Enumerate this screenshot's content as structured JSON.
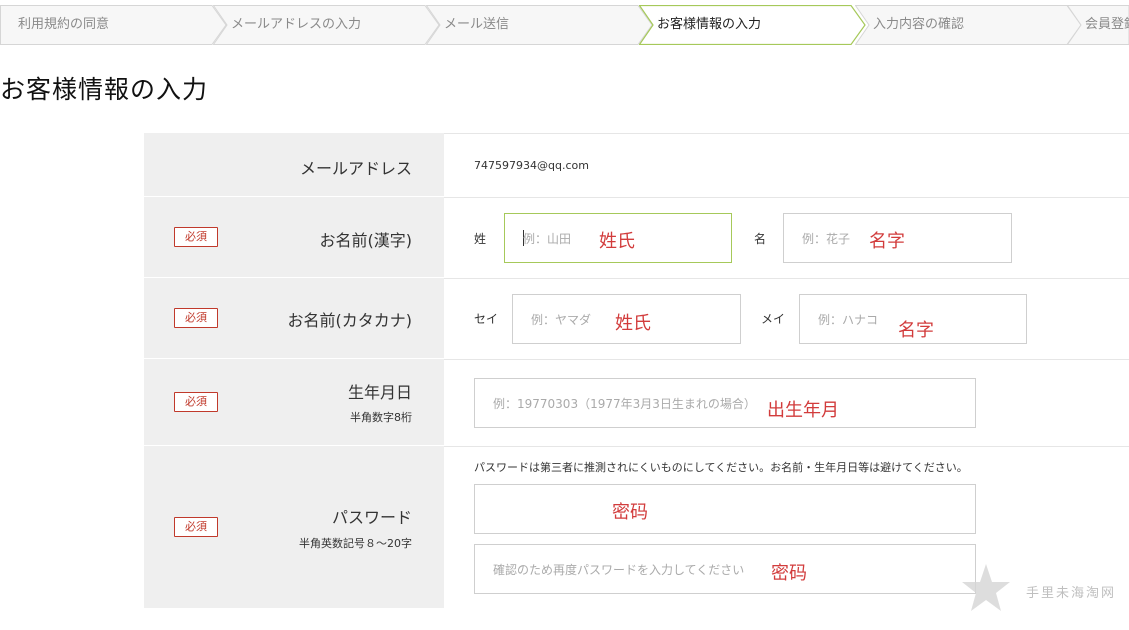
{
  "steps": [
    {
      "label": "利用規約の同意",
      "active": false
    },
    {
      "label": "メールアドレスの入力",
      "active": false
    },
    {
      "label": "メール送信",
      "active": false
    },
    {
      "label": "お客様情報の入力",
      "active": true
    },
    {
      "label": "入力内容の確認",
      "active": false
    },
    {
      "label": "会員登録",
      "active": false
    }
  ],
  "page_title": "お客様情報の入力",
  "required_badge": "必須",
  "email": {
    "label": "メールアドレス",
    "value": "747597934@qq.com"
  },
  "name_kanji": {
    "label": "お名前(漢字)",
    "last_label": "姓",
    "last_placeholder": "例：山田",
    "last_note": "姓氏",
    "first_label": "名",
    "first_placeholder": "例：花子",
    "first_note": "名字"
  },
  "name_kana": {
    "label": "お名前(カタカナ)",
    "last_label": "セイ",
    "last_placeholder": "例：ヤマダ",
    "last_note": "姓氏",
    "first_label": "メイ",
    "first_placeholder": "例：ハナコ",
    "first_note": "名字"
  },
  "birthday": {
    "label": "生年月日",
    "sub": "半角数字8桁",
    "placeholder": "例：19770303（1977年3月3日生まれの場合）",
    "note": "出生年月"
  },
  "password": {
    "label": "パスワード",
    "sub": "半角英数記号８〜20字",
    "hint": "パスワードは第三者に推測されにくいものにしてください。お名前・生年月日等は避けてください。",
    "note": "密码",
    "confirm_placeholder": "確認のため再度パスワードを入力してください",
    "confirm_note": "密码"
  },
  "watermark": "手里未海淘网",
  "colors": {
    "active_step_border": "#a6c95a",
    "required": "#c0392b",
    "annotation": "#d23c3c"
  }
}
